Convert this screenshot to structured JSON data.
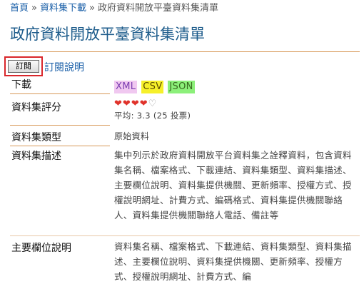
{
  "breadcrumb": {
    "home": "首頁",
    "sep1": "»",
    "download": "資料集下載",
    "sep2": "»",
    "current": "政府資料開放平臺資料集清單"
  },
  "page_title": "政府資料開放平臺資料集清單",
  "subscribe": {
    "button": "訂閱",
    "link": "訂閱說明"
  },
  "rows": {
    "download": {
      "label": "下載",
      "formats": [
        "XML",
        "CSV",
        "JSON"
      ]
    },
    "rating": {
      "label": "資料集評分",
      "stars_filled": 4,
      "stars_total": 5,
      "average_text": "平均: 3.3 (25 投票)"
    },
    "type": {
      "label": "資料集類型",
      "value": "原始資料"
    },
    "description": {
      "label": "資料集描述",
      "value": "集中列示於政府資料開放平台資料集之詮釋資料，包含資料集名稱、檔案格式、下載連結、資料集類型、資料集描述、主要欄位說明、資料集提供機關、更新頻率、授權方式、授權說明網址、計費方式、編碼格式、資料集提供機關聯絡人、資料集提供機關聯絡人電話、備註等"
    },
    "fields": {
      "label": "主要欄位說明",
      "value": "資料集名稱、檔案格式、下載連結、資料集類型、資料集描述、主要欄位說明、資料集提供機關、更新頻率、授權方式、授權說明網址、計費方式、編"
    }
  },
  "colors": {
    "title": "#1f5d8c",
    "link": "#1a5fa8",
    "rule": "#d89a5a",
    "highlight_box": "#d9262b",
    "star": "#e0332b"
  }
}
